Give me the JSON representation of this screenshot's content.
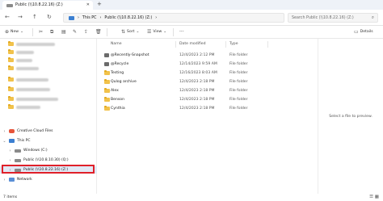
{
  "window": {
    "tab_title": "Public (\\\\10.8.22.16) (Z:)",
    "tab_close": "✕",
    "new_tab": "+"
  },
  "address_bar": {
    "back": "←",
    "forward": "→",
    "up": "↑",
    "refresh": "↻",
    "path": [
      "This PC",
      "Public (\\\\10.8.22.16) (Z:)"
    ],
    "separator": "›",
    "search_placeholder": "Search Public (\\\\10.8.22.16) (Z:)"
  },
  "toolbar": {
    "new_label": "New",
    "sort_label": "Sort",
    "view_label": "View",
    "more": "···",
    "details_label": "Details"
  },
  "sidebar": {
    "this_pc_label": "This PC",
    "creative_cloud_label": "Creative Cloud Files",
    "windows_drive_label": "Windows (C:)",
    "q_drive_label": "Public (\\\\10.8.10.30) (Q:)",
    "z_drive_label": "Public (\\\\10.8.22.16) (Z:)",
    "network_label": "Network"
  },
  "columns": {
    "name": "Name",
    "date_modified": "Date modified",
    "type": "Type"
  },
  "files": [
    {
      "name": "@Recently-Snapshot",
      "date": "12/4/2023 2:12 PM",
      "type": "File folder",
      "icon": "snapshot-icon"
    },
    {
      "name": "@Recycle",
      "date": "12/14/2023 9:59 AM",
      "type": "File folder",
      "icon": "recycle-icon"
    },
    {
      "name": "Testing",
      "date": "12/16/2023 8:03 AM",
      "type": "File folder",
      "icon": "folder-icon"
    },
    {
      "name": "Qulog archive",
      "date": "12/4/2023 2:18 PM",
      "type": "File folder",
      "icon": "folder-icon"
    },
    {
      "name": "Alex",
      "date": "12/4/2023 2:18 PM",
      "type": "File folder",
      "icon": "folder-icon"
    },
    {
      "name": "Benson",
      "date": "12/4/2023 2:18 PM",
      "type": "File folder",
      "icon": "folder-icon"
    },
    {
      "name": "Cynthia",
      "date": "12/4/2023 2:18 PM",
      "type": "File folder",
      "icon": "folder-icon"
    }
  ],
  "preview": {
    "empty_text": "Select a file to preview."
  },
  "status": {
    "item_count": "7 items"
  },
  "colors": {
    "folder": "#f1c24b",
    "selection": "#e1e9f5",
    "highlight_box": "#e0202a"
  }
}
